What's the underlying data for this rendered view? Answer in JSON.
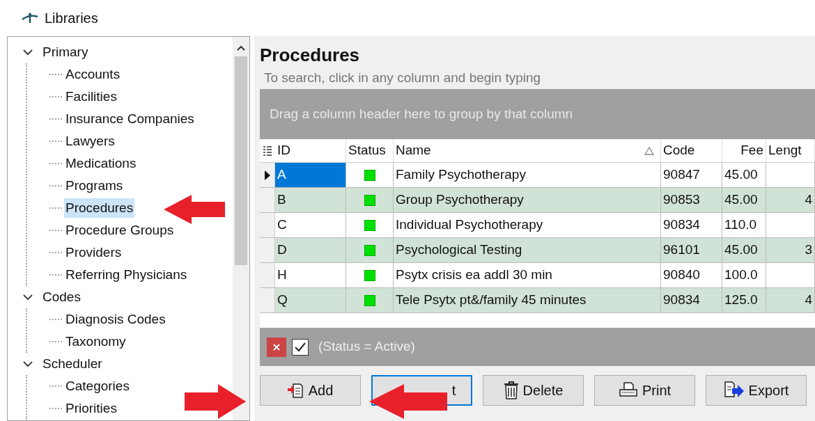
{
  "header": {
    "title": "Libraries"
  },
  "tree": [
    {
      "label": "Primary",
      "expanded": true,
      "children": [
        {
          "label": "Accounts",
          "selected": false
        },
        {
          "label": "Facilities",
          "selected": false
        },
        {
          "label": "Insurance Companies",
          "selected": false
        },
        {
          "label": "Lawyers",
          "selected": false
        },
        {
          "label": "Medications",
          "selected": false
        },
        {
          "label": "Programs",
          "selected": false
        },
        {
          "label": "Procedures",
          "selected": true
        },
        {
          "label": "Procedure Groups",
          "selected": false
        },
        {
          "label": "Providers",
          "selected": false
        },
        {
          "label": "Referring Physicians",
          "selected": false
        }
      ]
    },
    {
      "label": "Codes",
      "expanded": true,
      "children": [
        {
          "label": "Diagnosis Codes",
          "selected": false
        },
        {
          "label": "Taxonomy",
          "selected": false
        }
      ]
    },
    {
      "label": "Scheduler",
      "expanded": true,
      "children": [
        {
          "label": "Categories",
          "selected": false
        },
        {
          "label": "Priorities",
          "selected": false
        }
      ]
    }
  ],
  "panel": {
    "title": "Procedures",
    "hint": "To search, click in any column and begin typing",
    "group_hint": "Drag a column header here to group by that column"
  },
  "table": {
    "columns": [
      "ID",
      "Status",
      "Name",
      "Code",
      "Fee",
      "Lengt"
    ],
    "rows": [
      {
        "selected": true,
        "active": true,
        "cells": [
          "A",
          "",
          "Family Psychotherapy",
          "90847",
          "45.00",
          ""
        ]
      },
      {
        "selected": false,
        "active": true,
        "cells": [
          "B",
          "",
          "Group Psychotherapy",
          "90853",
          "45.00",
          "4"
        ]
      },
      {
        "selected": false,
        "active": true,
        "cells": [
          "C",
          "",
          "Individual Psychotherapy",
          "90834",
          "110.0",
          ""
        ]
      },
      {
        "selected": false,
        "active": true,
        "cells": [
          "D",
          "",
          "Psychological Testing",
          "96101",
          "45.00",
          "3"
        ]
      },
      {
        "selected": false,
        "active": true,
        "cells": [
          "H",
          "",
          "Psytx crisis ea addl 30 min",
          "90840",
          "100.0",
          ""
        ]
      },
      {
        "selected": false,
        "active": true,
        "cells": [
          "Q",
          "",
          "Tele Psytx pt&/family 45 minutes",
          "90834",
          "125.0",
          "4"
        ]
      }
    ]
  },
  "filter": {
    "checked": true,
    "text": "(Status = Active)"
  },
  "buttons": [
    {
      "kind": "add",
      "label": "Add"
    },
    {
      "kind": "edit",
      "label": "t"
    },
    {
      "kind": "delete",
      "label": "Delete"
    },
    {
      "kind": "print",
      "label": "Print"
    },
    {
      "kind": "export",
      "label": "Export"
    }
  ]
}
